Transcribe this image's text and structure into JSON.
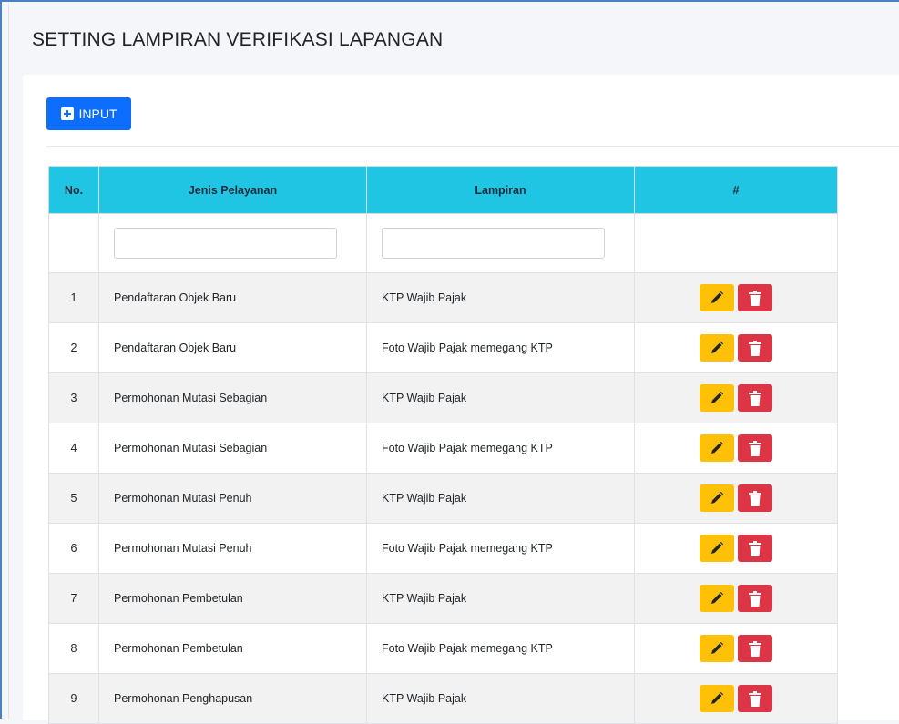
{
  "page": {
    "title": "SETTING LAMPIRAN VERIFIKASI LAPANGAN"
  },
  "toolbar": {
    "input_label": "INPUT",
    "input_icon": "plus-square-icon"
  },
  "colors": {
    "header_bg": "#20c5e3",
    "primary": "#0d6efd",
    "edit": "#ffc107",
    "delete": "#dc3545"
  },
  "table": {
    "headers": {
      "no": "No.",
      "jenis": "Jenis Pelayanan",
      "lampiran": "Lampiran",
      "actions": "#"
    },
    "filters": {
      "jenis": "",
      "lampiran": ""
    },
    "rows": [
      {
        "no": "1",
        "jenis": "Pendaftaran Objek Baru",
        "lampiran": "KTP Wajib Pajak"
      },
      {
        "no": "2",
        "jenis": "Pendaftaran Objek Baru",
        "lampiran": "Foto Wajib Pajak memegang KTP"
      },
      {
        "no": "3",
        "jenis": "Permohonan Mutasi Sebagian",
        "lampiran": "KTP Wajib Pajak"
      },
      {
        "no": "4",
        "jenis": "Permohonan Mutasi Sebagian",
        "lampiran": "Foto Wajib Pajak memegang KTP"
      },
      {
        "no": "5",
        "jenis": "Permohonan Mutasi Penuh",
        "lampiran": "KTP Wajib Pajak"
      },
      {
        "no": "6",
        "jenis": "Permohonan Mutasi Penuh",
        "lampiran": "Foto Wajib Pajak memegang KTP"
      },
      {
        "no": "7",
        "jenis": "Permohonan Pembetulan",
        "lampiran": "KTP Wajib Pajak"
      },
      {
        "no": "8",
        "jenis": "Permohonan Pembetulan",
        "lampiran": "Foto Wajib Pajak memegang KTP"
      },
      {
        "no": "9",
        "jenis": "Permohonan Penghapusan",
        "lampiran": "KTP Wajib Pajak"
      }
    ]
  }
}
